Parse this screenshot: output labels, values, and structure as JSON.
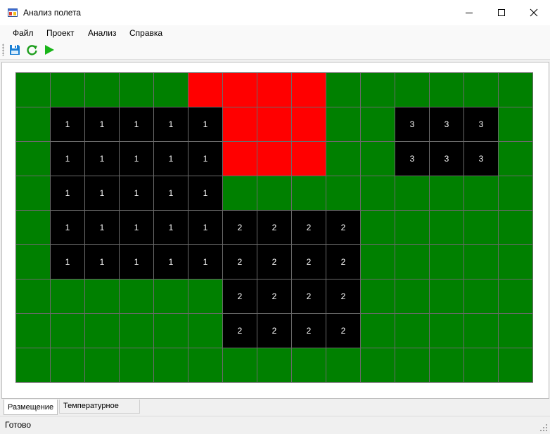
{
  "window": {
    "title": "Анализ полета"
  },
  "menu": {
    "items": [
      "Файл",
      "Проект",
      "Анализ",
      "Справка"
    ]
  },
  "toolbar": {
    "buttons": [
      "save-icon",
      "refresh-icon",
      "run-icon"
    ]
  },
  "grid": {
    "columns": 15,
    "rows": [
      [
        "",
        "",
        "",
        "",
        "",
        "R",
        "R",
        "R",
        "R",
        "",
        "",
        "",
        "",
        "",
        ""
      ],
      [
        "",
        "1",
        "1",
        "1",
        "1",
        "1",
        "R",
        "R",
        "R",
        "",
        "",
        "3",
        "3",
        "3",
        ""
      ],
      [
        "",
        "1",
        "1",
        "1",
        "1",
        "1",
        "R",
        "R",
        "R",
        "",
        "",
        "3",
        "3",
        "3",
        ""
      ],
      [
        "",
        "1",
        "1",
        "1",
        "1",
        "1",
        "",
        "",
        "",
        "",
        "",
        "",
        "",
        "",
        ""
      ],
      [
        "",
        "1",
        "1",
        "1",
        "1",
        "1",
        "2",
        "2",
        "2",
        "2",
        "",
        "",
        "",
        "",
        ""
      ],
      [
        "",
        "1",
        "1",
        "1",
        "1",
        "1",
        "2",
        "2",
        "2",
        "2",
        "",
        "",
        "",
        "",
        ""
      ],
      [
        "",
        "",
        "",
        "",
        "",
        "",
        "2",
        "2",
        "2",
        "2",
        "",
        "",
        "",
        "",
        ""
      ],
      [
        "",
        "",
        "",
        "",
        "",
        "",
        "2",
        "2",
        "2",
        "2",
        "",
        "",
        "",
        "",
        ""
      ],
      [
        "",
        "",
        "",
        "",
        "",
        "",
        "",
        "",
        "",
        "",
        "",
        "",
        "",
        "",
        ""
      ]
    ],
    "colors": {
      "free": "#008000",
      "zone": "#ff0000",
      "object": "#000000",
      "line": "#6a6a6a",
      "text": "#ffffff"
    }
  },
  "tabs": [
    {
      "label": "Размещение",
      "active": true
    },
    {
      "label": "Температурное поле",
      "active": false
    }
  ],
  "status": {
    "text": "Готово"
  }
}
